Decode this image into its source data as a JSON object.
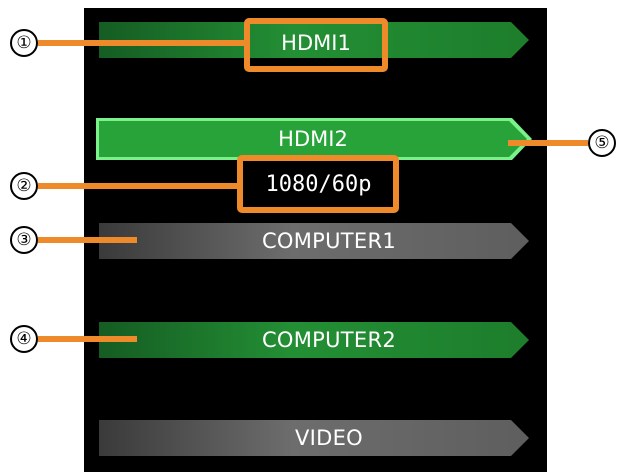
{
  "inputs": [
    {
      "label": "HDMI1",
      "state": "available"
    },
    {
      "label": "HDMI2",
      "state": "selected",
      "resolution": "1080/60p"
    },
    {
      "label": "COMPUTER1",
      "state": "unavailable"
    },
    {
      "label": "COMPUTER2",
      "state": "available"
    },
    {
      "label": "VIDEO",
      "state": "unavailable"
    }
  ],
  "callouts": [
    "①",
    "②",
    "③",
    "④",
    "⑤"
  ],
  "colors": {
    "available": "#238f34",
    "selected_outline": "#7cf08a",
    "unavailable": "#6d6d6d",
    "highlight": "#ef8a2a",
    "background": "#000000"
  }
}
